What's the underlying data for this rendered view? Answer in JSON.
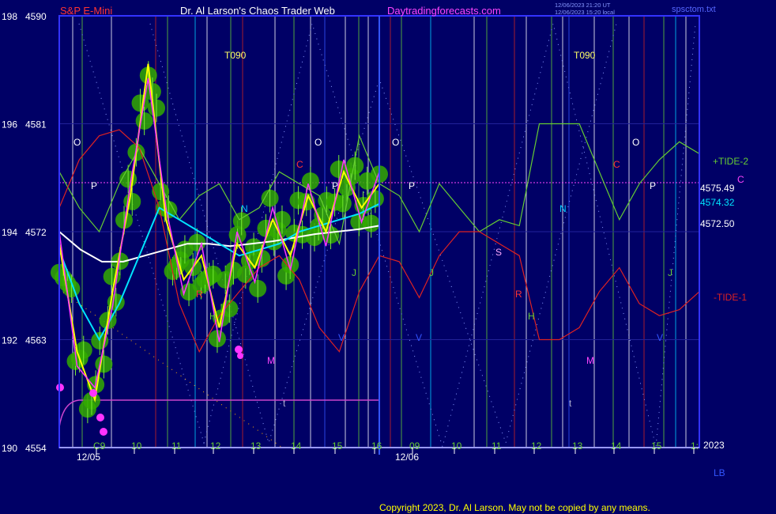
{
  "header": {
    "symbol": "S&P E-Mini",
    "title": "Dr. Al Larson's Chaos Trader Web",
    "site": "Daytradingforecasts.com",
    "timestamp_line1": "12/06/2023 21:20 UT",
    "timestamp_line2": "12/06/2023 15:20 local",
    "file": "spsctom.txt"
  },
  "footer": {
    "copyright": "Copyright 2023, Dr. Al Larson. May not be copied by any means.",
    "year": "2023",
    "lb": "LB"
  },
  "colors": {
    "background": "#000066",
    "axis": "#3333ff",
    "label_red": "#ff3333",
    "label_white": "#ffffff",
    "label_magenta": "#ff00ff",
    "tide_green": "#66cc33",
    "tide_red": "#cc2222",
    "price_yellow": "#ffff00",
    "ma_cyan": "#00e5ff",
    "ma_white": "#ffffff",
    "bubble_green": "#33aa00"
  },
  "chart_data": {
    "type": "line",
    "y_axis": {
      "ticks": [
        {
          "left": "198",
          "right": "4590"
        },
        {
          "left": "196",
          "right": "4581"
        },
        {
          "left": "194",
          "right": "4572"
        },
        {
          "left": "192",
          "right": "4563"
        },
        {
          "left": "190",
          "right": "4554"
        }
      ],
      "ylim": [
        4554,
        4590
      ]
    },
    "x_axis": {
      "hour_ticks": [
        "C9",
        "10",
        "11",
        "12",
        "13",
        "14",
        "15",
        "16",
        "09",
        "10",
        "11",
        "12",
        "13",
        "14",
        "15",
        "1:"
      ],
      "date_labels": [
        "12/05",
        "12/06"
      ]
    },
    "right_labels": {
      "tide_plus": "+TIDE-2",
      "tide_minus": "-TIDE-1",
      "c_marker": "C",
      "value_a": "4575.49",
      "value_b": "4574.32",
      "value_c": "4572.50"
    },
    "markers": {
      "o": "O",
      "p": "P",
      "c": "C",
      "n": "N",
      "j": "J",
      "r": "R",
      "h": "H",
      "m": "M",
      "s": "S",
      "t": "t",
      "v": "V",
      "t090": "T090"
    },
    "series": [
      {
        "name": "+TIDE-2",
        "color": "#66cc33",
        "values": [
          4577,
          4574,
          4572,
          4576,
          4579,
          4576,
          4573,
          4575,
          4576,
          4573,
          4574,
          4577,
          4576,
          4575,
          4571,
          4580,
          4576,
          4575,
          4572,
          4576,
          4574,
          4572,
          4573,
          4572.5,
          4581,
          4581,
          4581,
          4577,
          4573,
          4576,
          4578,
          4579.5,
          4578.5
        ]
      },
      {
        "name": "-TIDE-1",
        "color": "#cc2222",
        "values": [
          4574,
          4578,
          4580,
          4580.5,
          4579,
          4574,
          4566,
          4562,
          4565,
          4567,
          4569,
          4570,
          4568,
          4564,
          4562,
          4567,
          4570,
          4569.5,
          4566.5,
          4570,
          4572,
          4572,
          4571,
          4570,
          4563,
          4563,
          4564,
          4567,
          4569,
          4566,
          4565,
          4565.5,
          4567
        ]
      },
      {
        "name": "4575.49",
        "color": "#ffff00",
        "values": [
          4571,
          4562,
          4558,
          4567,
          4575,
          4586,
          4573,
          4568,
          4570,
          4564,
          4571,
          4569,
          4573,
          4570,
          4575,
          4572,
          4577,
          4574,
          4576
        ]
      },
      {
        "name": "4574.32",
        "color": "#00e5ff",
        "values": [
          4570.5,
          4566,
          4563,
          4566,
          4570,
          4574,
          4573,
          4572,
          4571,
          4570,
          4570.5,
          4571,
          4572,
          4572.5,
          4573,
          4573.5,
          4574.32
        ]
      },
      {
        "name": "4572.50",
        "color": "#ffffff",
        "values": [
          4572,
          4570.5,
          4569.5,
          4569.5,
          4570,
          4570.5,
          4571,
          4571,
          4570.8,
          4571,
          4571.2,
          4571.5,
          4571.8,
          4572,
          4572.2,
          4572.5
        ]
      }
    ]
  }
}
